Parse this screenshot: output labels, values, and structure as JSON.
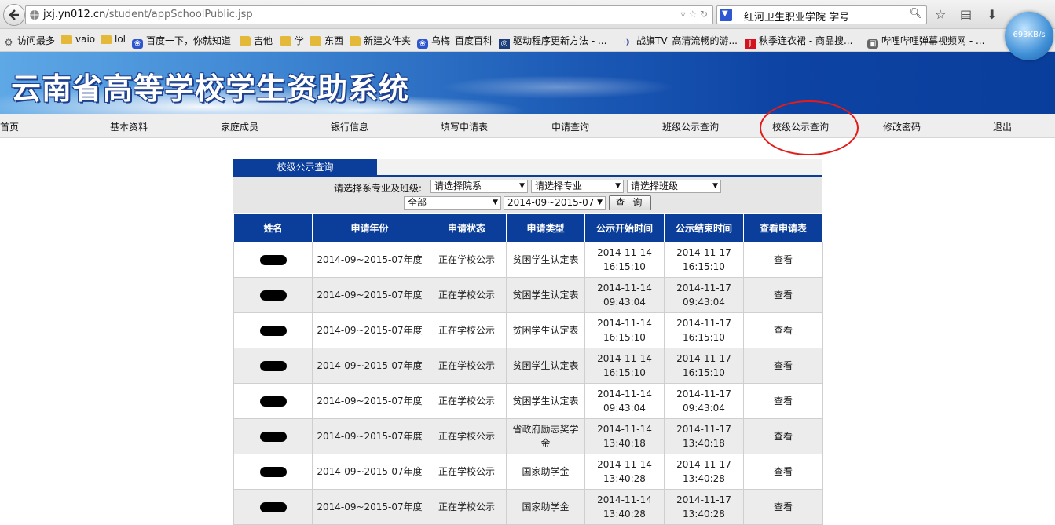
{
  "browser": {
    "url_host": "jxj.yn012.cn",
    "url_path": "/student/appSchoolPublic.jsp",
    "search_text": "红河卫生职业学院 学号",
    "speed": "693KB/s",
    "bookmarks": [
      {
        "label": "访问最多",
        "icon": "gear-icon"
      },
      {
        "label": "vaio",
        "icon": "folder-icon"
      },
      {
        "label": "lol",
        "icon": "folder-icon"
      },
      {
        "label": "百度一下，你就知道",
        "icon": "baidu-paw-icon"
      },
      {
        "label": "吉他",
        "icon": "folder-icon"
      },
      {
        "label": "学",
        "icon": "folder-icon"
      },
      {
        "label": "东西",
        "icon": "folder-icon"
      },
      {
        "label": "新建文件夹",
        "icon": "folder-icon"
      },
      {
        "label": "乌梅_百度百科",
        "icon": "baidu-paw-icon"
      },
      {
        "label": "驱动程序更新方法 - ...",
        "icon": "site-icon"
      },
      {
        "label": "战旗TV_高清流畅的游...",
        "icon": "plane-icon"
      },
      {
        "label": "秋季连衣裙 - 商品搜...",
        "icon": "jd-icon"
      },
      {
        "label": "哔哩哔哩弹幕视频网 - ...",
        "icon": "tv-icon"
      }
    ]
  },
  "site": {
    "title": "云南省高等学校学生资助系统",
    "menu": [
      "首页",
      "基本资料",
      "家庭成员",
      "银行信息",
      "填写申请表",
      "申请查询",
      "班级公示查询",
      "校级公示查询",
      "修改密码",
      "退出"
    ]
  },
  "content": {
    "tab_label": "校级公示查询",
    "filter_label": "请选择系专业及班级:",
    "select_department": "请选择院系",
    "select_major": "请选择专业",
    "select_class": "请选择班级",
    "select_type": "全部",
    "select_year": "2014-09~2015-07",
    "query_button": "查 询",
    "headers": [
      "姓名",
      "申请年份",
      "申请状态",
      "申请类型",
      "公示开始时间",
      "公示结束时间",
      "查看申请表"
    ],
    "rows": [
      {
        "year": "2014-09~2015-07年度",
        "status": "正在学校公示",
        "type": "贫困学生认定表",
        "start_date": "2014-11-14",
        "start_time": "16:15:10",
        "end_date": "2014-11-17",
        "end_time": "16:15:10",
        "action": "查看"
      },
      {
        "year": "2014-09~2015-07年度",
        "status": "正在学校公示",
        "type": "贫困学生认定表",
        "start_date": "2014-11-14",
        "start_time": "09:43:04",
        "end_date": "2014-11-17",
        "end_time": "09:43:04",
        "action": "查看"
      },
      {
        "year": "2014-09~2015-07年度",
        "status": "正在学校公示",
        "type": "贫困学生认定表",
        "start_date": "2014-11-14",
        "start_time": "16:15:10",
        "end_date": "2014-11-17",
        "end_time": "16:15:10",
        "action": "查看"
      },
      {
        "year": "2014-09~2015-07年度",
        "status": "正在学校公示",
        "type": "贫困学生认定表",
        "start_date": "2014-11-14",
        "start_time": "16:15:10",
        "end_date": "2014-11-17",
        "end_time": "16:15:10",
        "action": "查看"
      },
      {
        "year": "2014-09~2015-07年度",
        "status": "正在学校公示",
        "type": "贫困学生认定表",
        "start_date": "2014-11-14",
        "start_time": "09:43:04",
        "end_date": "2014-11-17",
        "end_time": "09:43:04",
        "action": "查看"
      },
      {
        "year": "2014-09~2015-07年度",
        "status": "正在学校公示",
        "type": "省政府励志奖学金",
        "start_date": "2014-11-14",
        "start_time": "13:40:18",
        "end_date": "2014-11-17",
        "end_time": "13:40:18",
        "action": "查看"
      },
      {
        "year": "2014-09~2015-07年度",
        "status": "正在学校公示",
        "type": "国家助学金",
        "start_date": "2014-11-14",
        "start_time": "13:40:28",
        "end_date": "2014-11-17",
        "end_time": "13:40:28",
        "action": "查看"
      },
      {
        "year": "2014-09~2015-07年度",
        "status": "正在学校公示",
        "type": "国家助学金",
        "start_date": "2014-11-14",
        "start_time": "13:40:28",
        "end_date": "2014-11-17",
        "end_time": "13:40:28",
        "action": "查看"
      }
    ]
  },
  "colors": {
    "header_blue": "#0b3e9a",
    "annotation_red": "#e21b1b"
  }
}
